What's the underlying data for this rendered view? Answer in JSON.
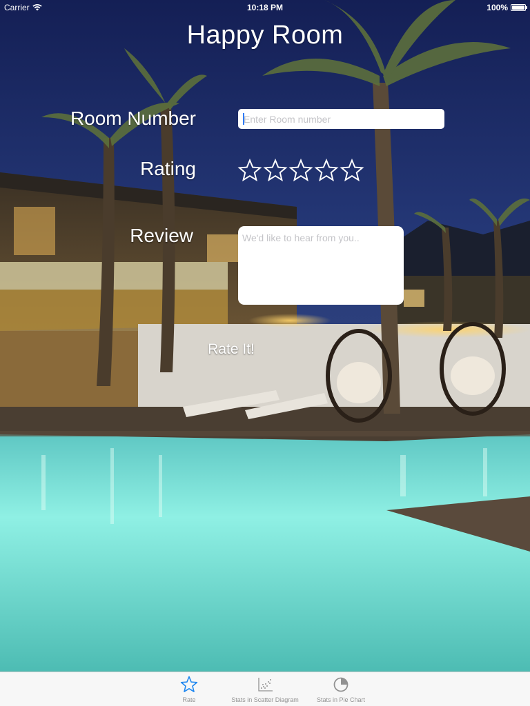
{
  "status_bar": {
    "carrier": "Carrier",
    "time": "10:18 PM",
    "battery": "100%",
    "battery_level": 1.0
  },
  "title": "Happy Room",
  "form": {
    "room_label": "Room Number",
    "room_placeholder": "Enter Room number",
    "room_value": "",
    "rating_label": "Rating",
    "rating_value": 0,
    "rating_max": 5,
    "review_label": "Review",
    "review_placeholder": "We'd like to hear from you..",
    "review_value": "",
    "submit_label": "Rate It!"
  },
  "tab_bar": {
    "tabs": [
      {
        "label": "Rate",
        "icon": "star-icon",
        "active": true
      },
      {
        "label": "Stats in Scatter Diagram",
        "icon": "scatter-chart-icon",
        "active": false
      },
      {
        "label": "Stats in Pie Chart",
        "icon": "pie-chart-icon",
        "active": false
      }
    ]
  },
  "colors": {
    "accent": "#1e87f0",
    "tab_inactive": "#929292",
    "text_on_background": "#ffffff"
  }
}
